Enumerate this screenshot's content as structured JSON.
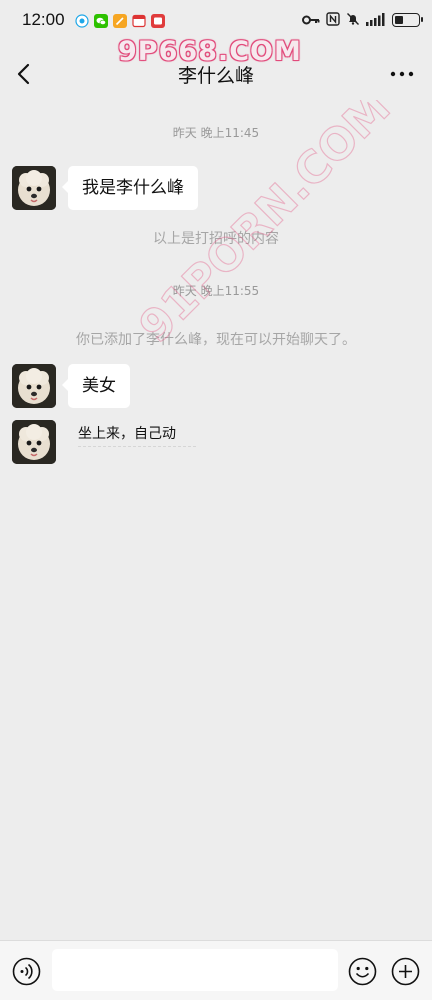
{
  "status_bar": {
    "time": "12:00",
    "notification_icons": [
      "qq-icon",
      "wechat-icon",
      "pencil-app-icon",
      "calendar-icon",
      "video-app-icon"
    ],
    "battery_level": 0.35
  },
  "watermark": {
    "top": "9P668.COM",
    "diagonal": "91PORN.COM"
  },
  "header": {
    "title": "李什么峰"
  },
  "messages": {
    "ts1": "昨天 晚上11:45",
    "bubble1": "我是李什么峰",
    "sys1": "以上是打招呼的内容",
    "ts2": "昨天 晚上11:55",
    "sys2": "你已添加了李什么峰，现在可以开始聊天了。",
    "bubble2": "美女",
    "text3": "坐上来，自己动"
  },
  "input_bar": {
    "value": "",
    "placeholder": ""
  },
  "colors": {
    "background": "#ededed",
    "bubble": "#ffffff",
    "watermark": "#e24c7c"
  }
}
